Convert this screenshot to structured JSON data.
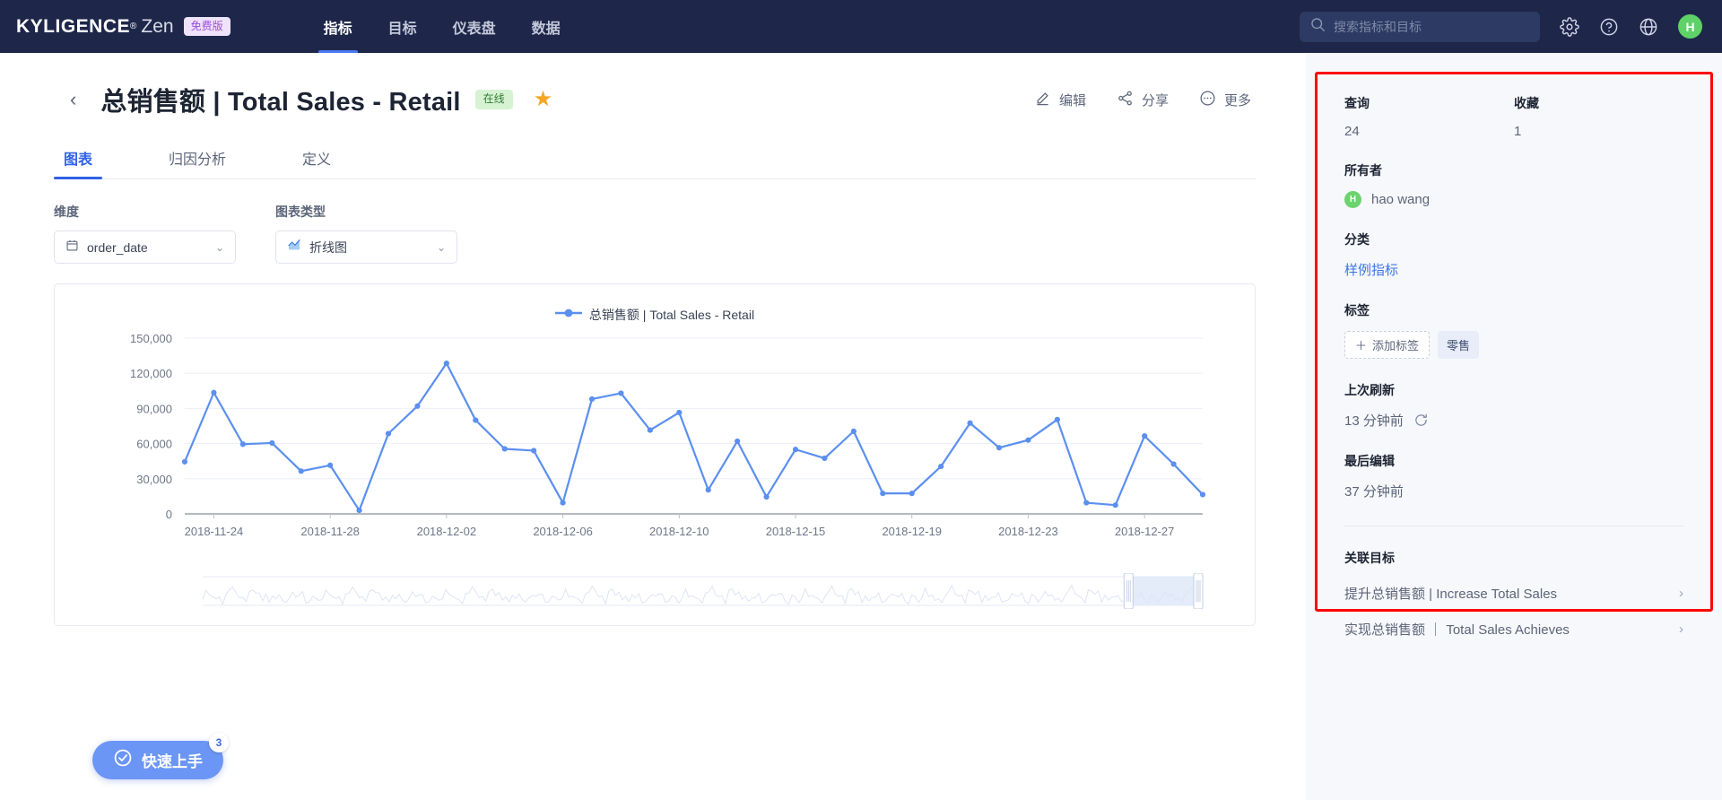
{
  "topnav": {
    "brand_main": "KYLIGENCE",
    "brand_reg": "®",
    "brand_sub": "Zen",
    "brand_badge": "免费版",
    "items": [
      {
        "label": "指标",
        "active": true
      },
      {
        "label": "目标",
        "active": false
      },
      {
        "label": "仪表盘",
        "active": false
      },
      {
        "label": "数据",
        "active": false
      }
    ],
    "search_placeholder": "搜索指标和目标",
    "search_value": "",
    "icons": [
      "gear-icon",
      "help-icon",
      "globe-icon"
    ],
    "avatar_initial": "H",
    "bg_color": "#1e2749",
    "accent_color": "#4a78f0"
  },
  "header": {
    "back_label": "‹",
    "title": "总销售额 | Total Sales - Retail",
    "status_badge": "在线",
    "status_color": "#2f7d32",
    "favorite_icon": "star-icon",
    "actions": [
      {
        "label": "编辑",
        "icon": "pencil-icon"
      },
      {
        "label": "分享",
        "icon": "share-icon"
      },
      {
        "label": "更多",
        "icon": "more-ellipsis-icon"
      }
    ]
  },
  "tabs": [
    {
      "label": "图表",
      "active": true
    },
    {
      "label": "归因分析",
      "active": false
    },
    {
      "label": "定义",
      "active": false
    }
  ],
  "selectors": [
    {
      "label": "维度",
      "value": "order_date",
      "icon": "calendar-icon",
      "caret": "⌄"
    },
    {
      "label": "图表类型",
      "value": "折线图",
      "icon": "line-chart-icon",
      "caret": "⌄"
    }
  ],
  "chart_data": {
    "type": "line",
    "title": "",
    "legend": [
      "总销售额 | Total Sales - Retail"
    ],
    "legend_position": "top-center",
    "series_color": "#5b8ff0",
    "xlabel": "",
    "ylabel": "",
    "grid": true,
    "ylim": [
      0,
      150000
    ],
    "yticks": [
      0,
      30000,
      60000,
      90000,
      120000,
      150000
    ],
    "ytick_labels": [
      "0",
      "30,000",
      "60,000",
      "90,000",
      "120,000",
      "150,000"
    ],
    "xtick_labels": [
      "2018-11-24",
      "2018-11-28",
      "2018-12-02",
      "2018-12-06",
      "2018-12-10",
      "2018-12-15",
      "2018-12-19",
      "2018-12-23",
      "2018-12-27"
    ],
    "xtick_indices": [
      1,
      5,
      9,
      13,
      17,
      21,
      25,
      29,
      33
    ],
    "x": [
      "2018-11-23",
      "2018-11-24",
      "2018-11-25",
      "2018-11-26",
      "2018-11-27",
      "2018-11-28",
      "2018-11-29",
      "2018-11-30",
      "2018-12-01",
      "2018-12-02",
      "2018-12-03",
      "2018-12-04",
      "2018-12-05",
      "2018-12-06",
      "2018-12-07",
      "2018-12-08",
      "2018-12-09",
      "2018-12-10",
      "2018-12-11",
      "2018-12-12",
      "2018-12-13",
      "2018-12-15",
      "2018-12-16",
      "2018-12-17",
      "2018-12-18",
      "2018-12-19",
      "2018-12-20",
      "2018-12-21",
      "2018-12-22",
      "2018-12-23",
      "2018-12-24",
      "2018-12-25",
      "2018-12-26",
      "2018-12-27",
      "2018-12-28",
      "2018-12-29"
    ],
    "series": [
      {
        "name": "总销售额 | Total Sales - Retail",
        "values": [
          44500,
          103500,
          59500,
          60500,
          36500,
          41500,
          3000,
          68500,
          92000,
          128500,
          80000,
          55500,
          54000,
          9500,
          98000,
          103000,
          71500,
          86500,
          20500,
          62000,
          14500,
          55000,
          47500,
          70500,
          17500,
          17500,
          40500,
          77500,
          56500,
          63000,
          80500,
          9500,
          7500,
          66500,
          42500,
          16500
        ]
      }
    ],
    "minimap": {
      "visible": true,
      "window_start_pct": 93,
      "window_end_pct": 100
    }
  },
  "quickstart": {
    "label": "快速上手",
    "badge": "3",
    "icon": "check-circle-icon"
  },
  "sidebar": {
    "stats": [
      {
        "label": "查询",
        "value": "24"
      },
      {
        "label": "收藏",
        "value": "1"
      }
    ],
    "owner": {
      "label": "所有者",
      "name": "hao wang",
      "initial": "H"
    },
    "category": {
      "label": "分类",
      "value": "样例指标"
    },
    "tags": {
      "label": "标签",
      "add_label": "添加标签",
      "items": [
        "零售"
      ]
    },
    "last_refresh": {
      "label": "上次刷新",
      "value": "13 分钟前",
      "icon": "refresh-icon"
    },
    "last_edit": {
      "label": "最后编辑",
      "value": "37 分钟前"
    },
    "related_goals": {
      "label": "关联目标",
      "items": [
        "提升总销售额 | Increase Total Sales",
        "实现总销售额 ｜ Total Sales Achieves"
      ]
    },
    "highlight_color": "#ff0000"
  }
}
